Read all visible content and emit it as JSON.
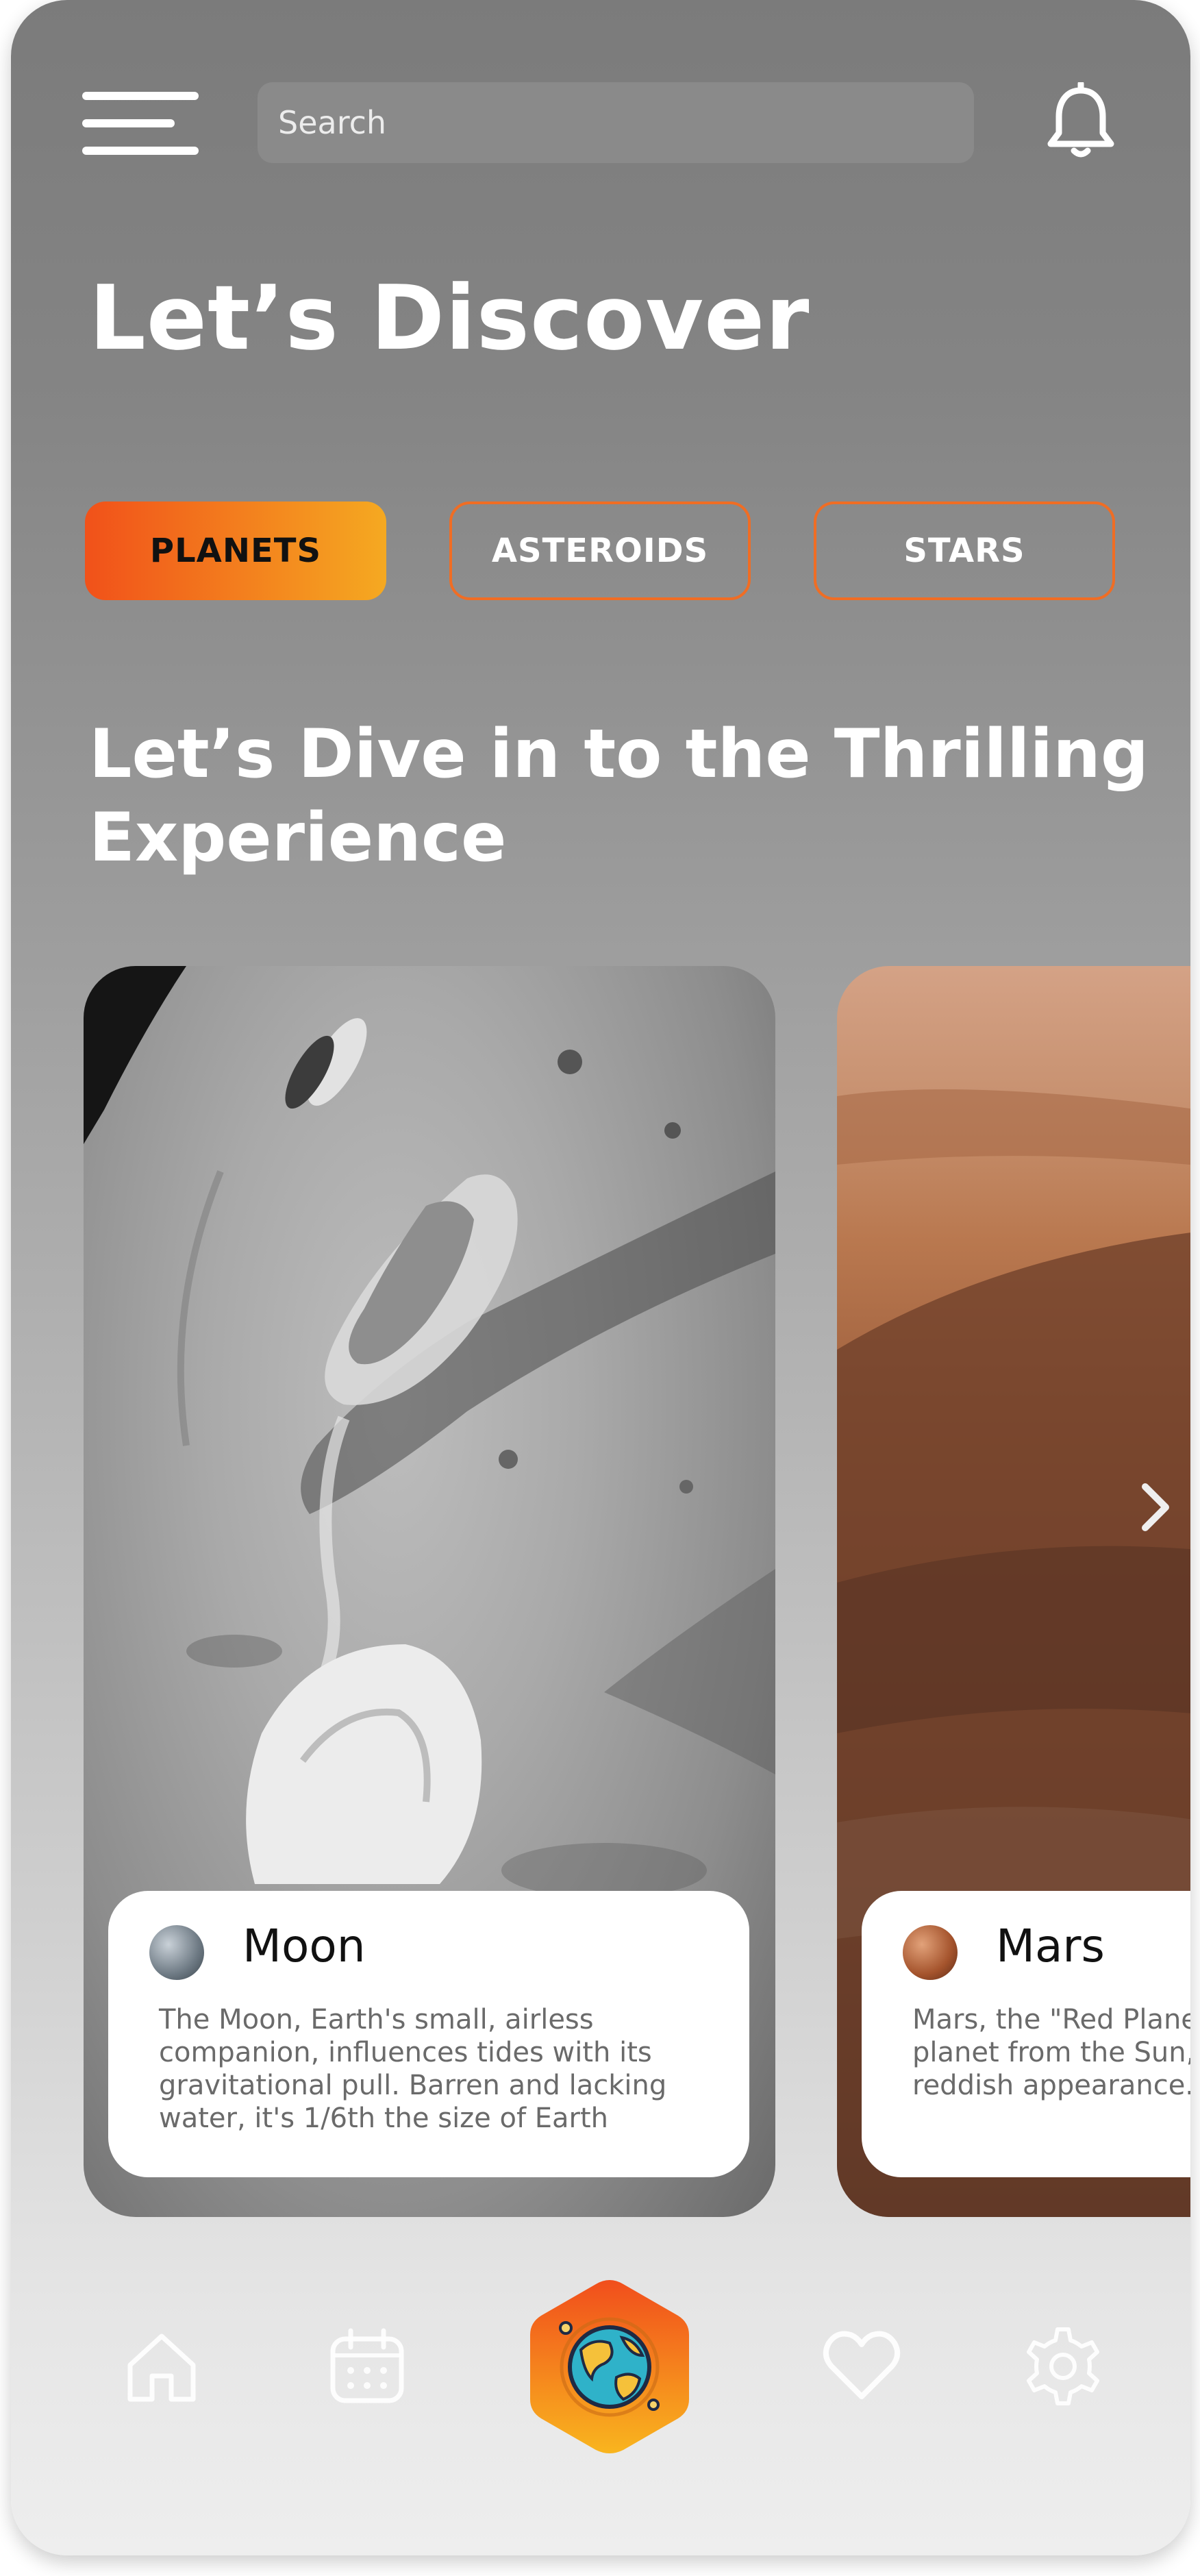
{
  "search": {
    "placeholder": "Search"
  },
  "headline": "Let’s Discover",
  "categories": [
    {
      "label": "PLANETS",
      "active": true
    },
    {
      "label": "ASTEROIDS",
      "active": false
    },
    {
      "label": "STARS",
      "active": false
    }
  ],
  "subheadline": "Let’s Dive in to the Thrilling Experience",
  "cards": [
    {
      "name": "Moon",
      "lines": [
        "The Moon, Earth's small, airless",
        "companion, influences tides with its",
        "gravitational pull. Barren and lacking",
        "water, it's 1/6th the size of Earth"
      ]
    },
    {
      "name": "Mars",
      "lines": [
        "Mars, the \"Red Planet,\" is the fourth",
        "planet from the Sun, known for its",
        "reddish appearance."
      ]
    }
  ],
  "icons": {
    "menu": "hamburger-menu-icon",
    "notifications": "bell-icon",
    "next": "chevron-right-icon",
    "nav": [
      "home-icon",
      "calendar-icon",
      "globe-icon",
      "heart-icon",
      "gear-icon"
    ]
  },
  "colors": {
    "accent_start": "#f1511a",
    "accent_end": "#f5a921"
  }
}
